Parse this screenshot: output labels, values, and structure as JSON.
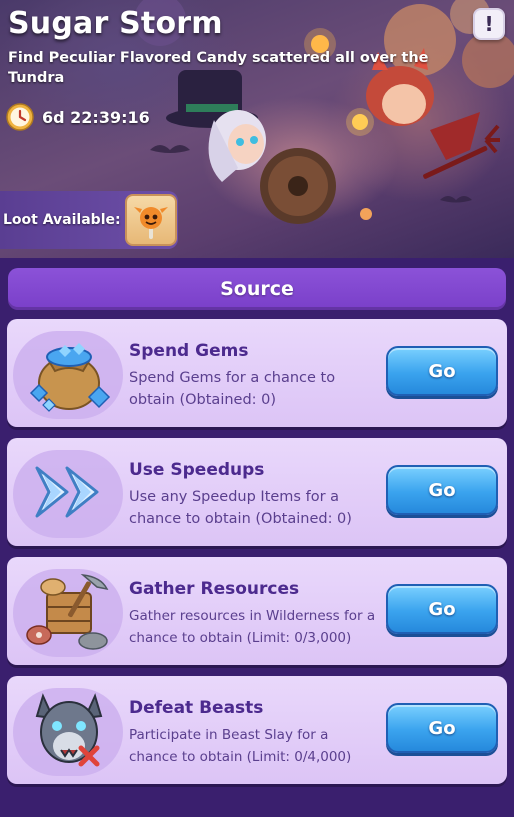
{
  "event": {
    "title": "Sugar Storm",
    "subtitle": "Find Peculiar Flavored Candy scattered all over the Tundra",
    "timer": "6d 22:39:16",
    "info_label": "!"
  },
  "loot": {
    "label": "Loot Available:",
    "item_icon": "candy-icon"
  },
  "source": {
    "header": "Source",
    "cards": [
      {
        "title": "Spend Gems",
        "description": "Spend Gems for a chance to obtain (Obtained: 0)",
        "button": "Go",
        "icon": "gem-sack-icon"
      },
      {
        "title": "Use Speedups",
        "description": "Use any Speedup Items for a chance to obtain (Obtained: 0)",
        "button": "Go",
        "icon": "speedup-arrows-icon"
      },
      {
        "title": "Gather Resources",
        "description": "Gather resources in Wilderness for a chance to obtain (Limit: 0/3,000)",
        "button": "Go",
        "icon": "resources-icon"
      },
      {
        "title": "Defeat Beasts",
        "description": "Participate in Beast Slay for a chance to obtain (Limit: 0/4,000)",
        "button": "Go",
        "icon": "beast-icon"
      }
    ]
  },
  "colors": {
    "background": "#3a1f6e",
    "header": "#7a3fc9",
    "card": "#e2cdf8",
    "card_title": "#4c2a8e",
    "button": "#3aa3ee"
  }
}
